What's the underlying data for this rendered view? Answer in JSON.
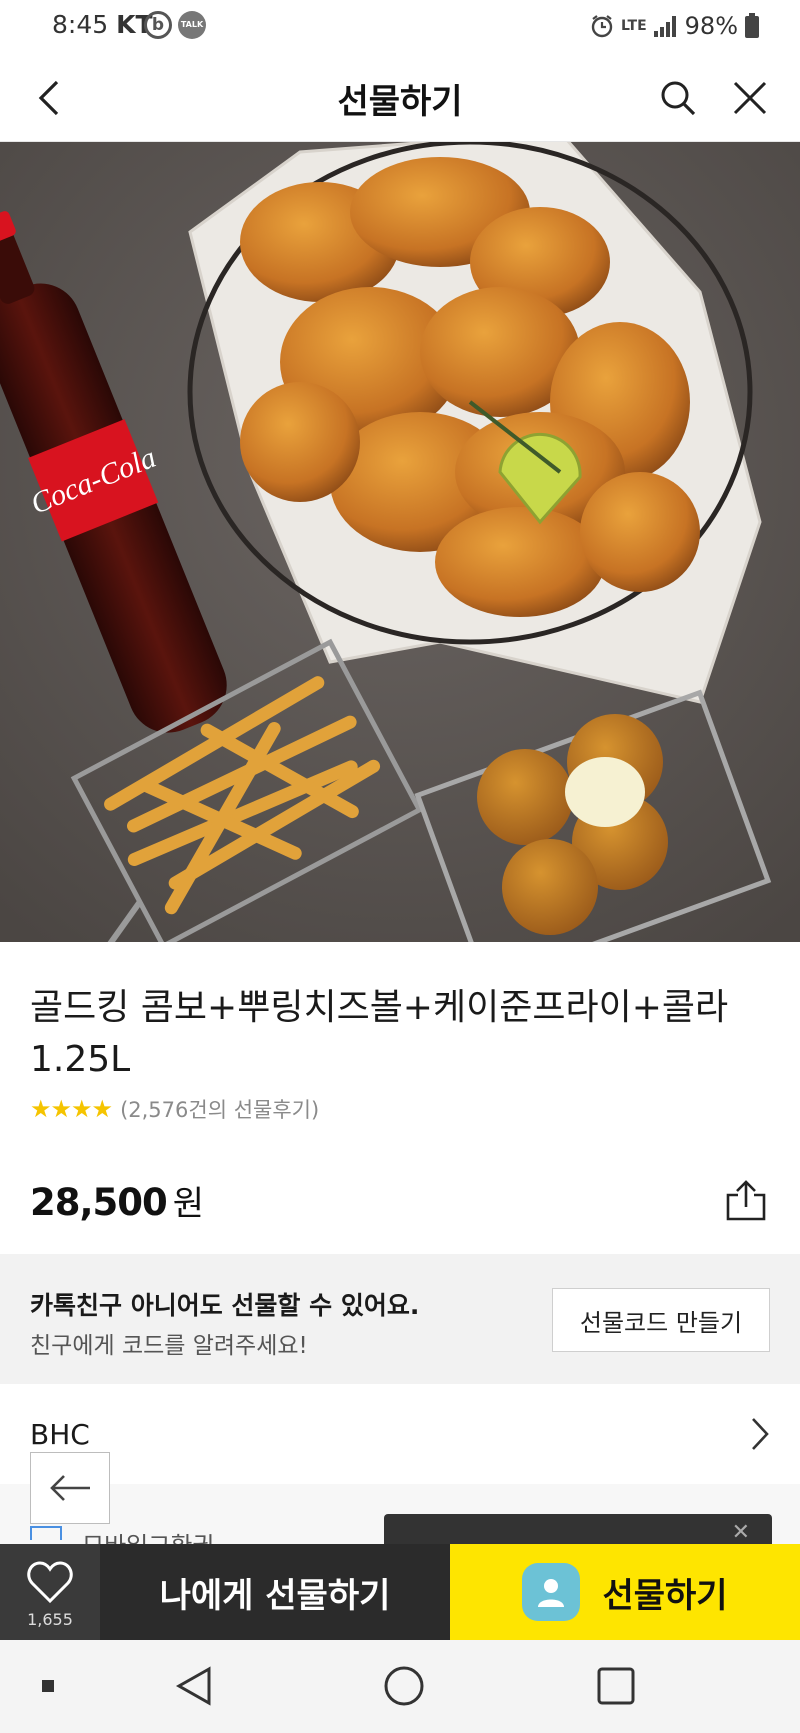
{
  "status_bar": {
    "time": "8:45",
    "carrier": "KT",
    "app_icon_b": "b",
    "talk_badge": "TALK",
    "network": "LTE",
    "battery": "98%"
  },
  "header": {
    "title": "선물하기",
    "icons": [
      "back-arrow-icon",
      "search-icon",
      "close-icon"
    ]
  },
  "product": {
    "title": "골드킹 콤보+뿌링치즈볼+케이준프라이+콜라 1.25L",
    "stars": "★★★★",
    "rating": 4,
    "review_count": "(2,576건의 선물후기)",
    "price": "28,500",
    "currency": "원"
  },
  "gift_code_banner": {
    "title": "카톡친구 아니어도 선물할 수 있어요.",
    "subtitle": "친구에게 코드를 알려주세요!",
    "button_label": "선물코드 만들기"
  },
  "brand": {
    "name": "BHC"
  },
  "partial_row": {
    "label": "모바일교환권"
  },
  "action_bar": {
    "like_count": "1,655",
    "self_gift_label": "나에게 선물하기",
    "gift_label": "선물하기"
  },
  "colors": {
    "accent_yellow": "#fee500",
    "dark_button": "#2b2b2b",
    "star": "#f5c400"
  }
}
